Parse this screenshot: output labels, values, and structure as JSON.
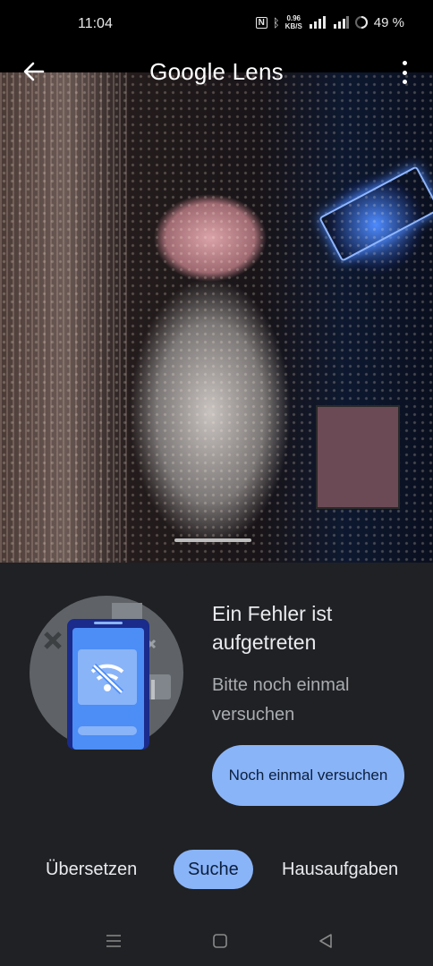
{
  "status_bar": {
    "time": "11:04",
    "speed_value": "0.96",
    "speed_unit": "KB/S",
    "battery": "49 %"
  },
  "header": {
    "brand": "Google Lens",
    "back_icon": "arrow-back-icon",
    "menu_icon": "more-vert-icon"
  },
  "error": {
    "title": "Ein Fehler ist aufgetreten",
    "subtitle": "Bitte noch einmal versuchen",
    "retry_label": "Noch einmal versuchen"
  },
  "tabs": [
    {
      "label": "Übersetzen",
      "active": false
    },
    {
      "label": "Suche",
      "active": true
    },
    {
      "label": "Hausaufgaben",
      "active": false
    }
  ],
  "colors": {
    "accent": "#8ab4f8",
    "sheet": "#202124"
  }
}
